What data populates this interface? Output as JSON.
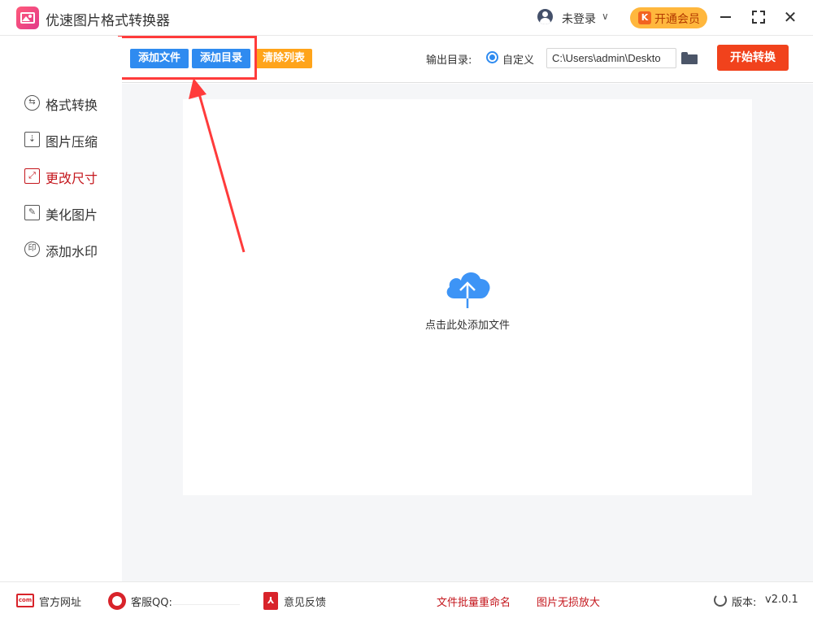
{
  "app": {
    "title": "优速图片格式转换器"
  },
  "header": {
    "login_label": "未登录",
    "chevron": "∨",
    "vip_label": "开通会员",
    "vip_icon": "K",
    "close_glyph": "✕"
  },
  "toolbar": {
    "add_file_label": "添加文件",
    "add_dir_label": "添加目录",
    "clear_list_label": "清除列表",
    "output_dir_label": "输出目录:",
    "custom_label": "自定义",
    "output_path": "C:\\Users\\admin\\Deskto",
    "start_label": "开始转换"
  },
  "sidebar": {
    "items": [
      {
        "label": "格式转换",
        "icon": "swap-icon",
        "glyph": "⇆",
        "active": false
      },
      {
        "label": "图片压缩",
        "icon": "compress-icon",
        "glyph": "⇣",
        "active": false
      },
      {
        "label": "更改尺寸",
        "icon": "resize-icon",
        "glyph": "⤢",
        "active": true
      },
      {
        "label": "美化图片",
        "icon": "beautify-icon",
        "glyph": "✎",
        "active": false
      },
      {
        "label": "添加水印",
        "icon": "watermark-icon",
        "glyph": "印",
        "active": false
      }
    ]
  },
  "main": {
    "drop_text": "点击此处添加文件"
  },
  "footer": {
    "website_label": "官方网址",
    "website_icon_text": "com",
    "qq_label": "客服QQ:",
    "feedback_label": "意见反馈",
    "rename_link": "文件批量重命名",
    "upscale_link": "图片无损放大",
    "version_label": "版本:",
    "version": "v2.0.1"
  },
  "colors": {
    "primary_blue": "#2f8bf0",
    "orange": "#ffa41a",
    "start_red": "#f1421c",
    "active_red": "#c4161c",
    "annotation_red": "#ff3b3b"
  }
}
